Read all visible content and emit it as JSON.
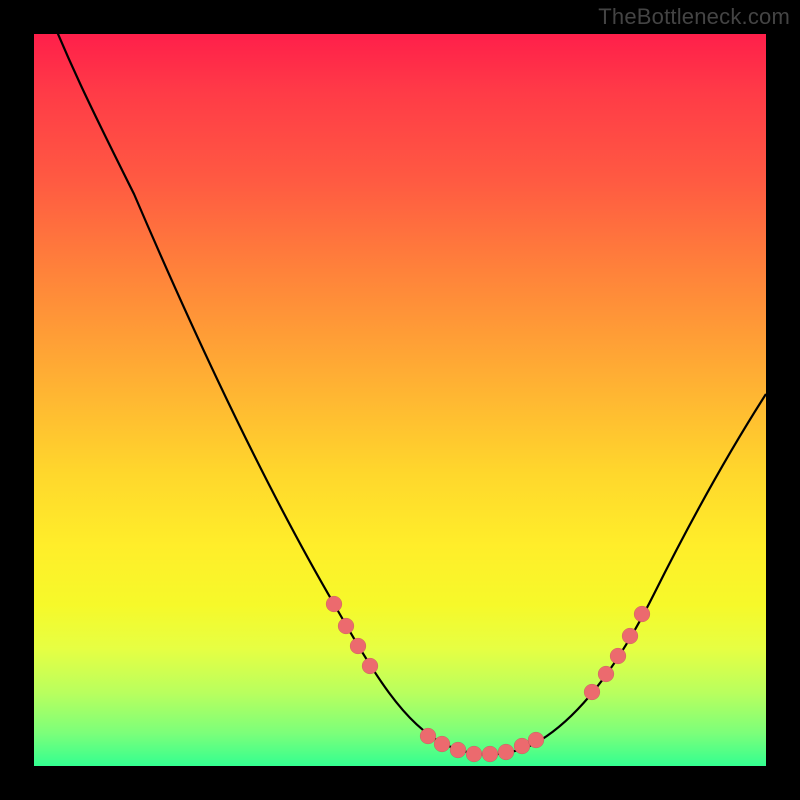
{
  "watermark": "TheBottleneck.com",
  "colors": {
    "bead": "#ec6a6e",
    "curve": "#000000",
    "frame": "#000000"
  },
  "chart_data": {
    "type": "line",
    "title": "",
    "xlabel": "",
    "ylabel": "",
    "xlim": [
      0,
      100
    ],
    "ylim": [
      0,
      100
    ],
    "grid": false,
    "legend": false,
    "series": [
      {
        "name": "curve",
        "x": [
          0,
          3,
          8,
          14,
          20,
          26,
          32,
          38,
          42,
          46,
          50,
          53,
          56,
          59,
          62,
          65,
          68,
          72,
          76,
          80,
          85,
          90,
          95,
          100
        ],
        "y": [
          108,
          100,
          90,
          78,
          66,
          54,
          42,
          30,
          22,
          14,
          8,
          5,
          3,
          2,
          2,
          3,
          5,
          9,
          15,
          22,
          31,
          40,
          48,
          54
        ]
      }
    ],
    "beads": {
      "name": "highlight-beads",
      "x_approx_percent": [
        40,
        42,
        44,
        52,
        54,
        56,
        58,
        60,
        62,
        64,
        66,
        74,
        76,
        78,
        80
      ],
      "y_approx_percent": [
        18,
        15,
        12,
        3,
        2,
        2,
        2,
        2,
        2,
        3,
        4,
        11,
        14,
        17,
        21
      ]
    }
  }
}
